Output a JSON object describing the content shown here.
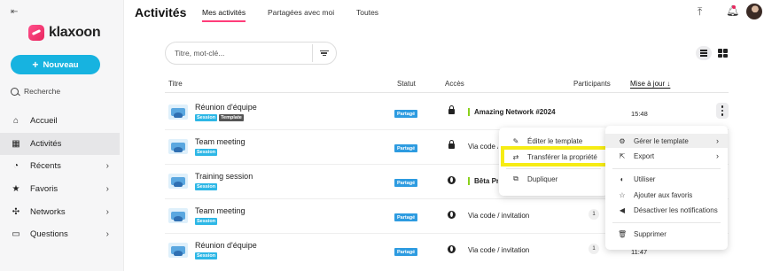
{
  "sidebar": {
    "collapse_icon": "collapse-sidebar-icon",
    "logo_text": "klaxoon",
    "new_button_label": "Nouveau",
    "search_label": "Recherche",
    "items": [
      {
        "label": "Accueil",
        "icon": "home-icon"
      },
      {
        "label": "Activités",
        "icon": "activities-icon",
        "active": true
      },
      {
        "label": "Récents",
        "icon": "recent-icon",
        "chevron": true
      },
      {
        "label": "Favoris",
        "icon": "star-icon",
        "chevron": true
      },
      {
        "label": "Networks",
        "icon": "networks-icon",
        "chevron": true
      },
      {
        "label": "Questions",
        "icon": "questions-icon",
        "chevron": true
      }
    ]
  },
  "header": {
    "title": "Activités",
    "tabs": [
      "Mes activités",
      "Partagées avec moi",
      "Toutes"
    ],
    "active_tab": "Mes activités"
  },
  "search": {
    "placeholder": "Titre, mot-clé..."
  },
  "table": {
    "columns": [
      "Titre",
      "Statut",
      "Accès",
      "Participants",
      "Mise à jour ↓"
    ],
    "rows": [
      {
        "title": "Réunion d'équipe",
        "badges": [
          "Session",
          "Template"
        ],
        "status": "Partagé",
        "access_icon": "lock-icon",
        "access": "Amazing Network #2024",
        "access_type": "network",
        "participants": "",
        "date": "15:48"
      },
      {
        "title": "Team meeting",
        "badges": [
          "Session"
        ],
        "status": "Partagé",
        "access_icon": "lock-icon",
        "access": "Via code / invitation",
        "access_type": "code",
        "participants": "",
        "date": ""
      },
      {
        "title": "Training session",
        "badges": [
          "Session"
        ],
        "status": "Partagé",
        "access_icon": "globe-icon",
        "access": "Bêta Pro",
        "access_type": "network",
        "participants": "",
        "date": ""
      },
      {
        "title": "Team meeting",
        "badges": [
          "Session"
        ],
        "status": "Partagé",
        "access_icon": "globe-icon",
        "access": "Via code / invitation",
        "access_type": "code",
        "participants": "1",
        "date": ""
      },
      {
        "title": "Réunion d'équipe",
        "badges": [
          "Session"
        ],
        "status": "Partagé",
        "access_icon": "globe-icon",
        "access": "Via code / invitation",
        "access_type": "code",
        "participants": "1",
        "date": "11:47"
      }
    ]
  },
  "submenu": {
    "items": [
      {
        "label": "Éditer le template",
        "icon": "pencil-icon"
      },
      {
        "label": "Transférer la propriété",
        "icon": "transfer-icon"
      },
      {
        "label": "Dupliquer",
        "icon": "duplicate-icon"
      }
    ]
  },
  "context_menu": {
    "items": [
      {
        "label": "Gérer le template",
        "icon": "gear-icon",
        "chevron": true
      },
      {
        "label": "Export",
        "icon": "export-icon",
        "chevron": true
      },
      {
        "label": "Utiliser",
        "icon": "toggle-icon"
      },
      {
        "label": "Ajouter aux favoris",
        "icon": "star-outline-icon"
      },
      {
        "label": "Désactiver les notifications",
        "icon": "mute-icon"
      },
      {
        "label": "Supprimer",
        "icon": "trash-icon"
      }
    ]
  },
  "colors": {
    "brand_pink": "#e8265e",
    "accent_blue": "#17b3e0",
    "status_blue": "#2d9be0",
    "highlight_yellow": "#f6ec14",
    "network_green": "#8bd11d"
  }
}
